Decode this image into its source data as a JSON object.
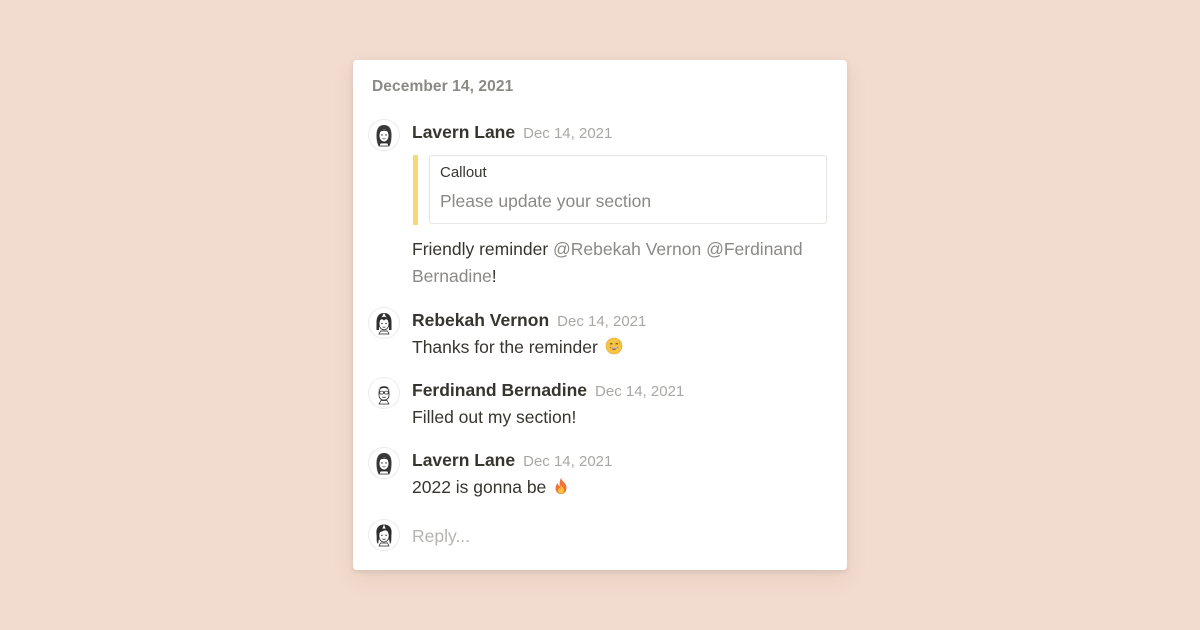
{
  "thread": {
    "date_header": "December 14, 2021",
    "comments": [
      {
        "author": "Lavern Lane",
        "timestamp": "Dec 14, 2021",
        "avatar_icon": "woman-long-hair-avatar-icon",
        "callout": {
          "title": "Callout",
          "placeholder": "Please update your section",
          "accent_color": "#f8d978"
        },
        "text_before": "Friendly reminder ",
        "mentions": [
          "@Rebekah Vernon",
          "@Ferdinand Bernadine"
        ],
        "text_after": "!"
      },
      {
        "author": "Rebekah Vernon",
        "timestamp": "Dec 14, 2021",
        "avatar_icon": "woman-bangs-avatar-icon",
        "text": "Thanks for the reminder",
        "emoji": "smiling-face-with-sweat-emoji-icon"
      },
      {
        "author": "Ferdinand Bernadine",
        "timestamp": "Dec 14, 2021",
        "avatar_icon": "man-glasses-avatar-icon",
        "text": "Filled out my section!"
      },
      {
        "author": "Lavern Lane",
        "timestamp": "Dec 14, 2021",
        "avatar_icon": "woman-long-hair-avatar-icon",
        "text": "2022 is gonna be",
        "emoji": "fire-emoji-icon"
      }
    ],
    "reply": {
      "placeholder": "Reply...",
      "avatar_icon": "current-user-avatar-icon"
    }
  },
  "colors": {
    "background": "#f2dccf",
    "card": "#ffffff",
    "text": "#37352f",
    "muted": "#8a8986",
    "callout_accent": "#f8d978"
  }
}
